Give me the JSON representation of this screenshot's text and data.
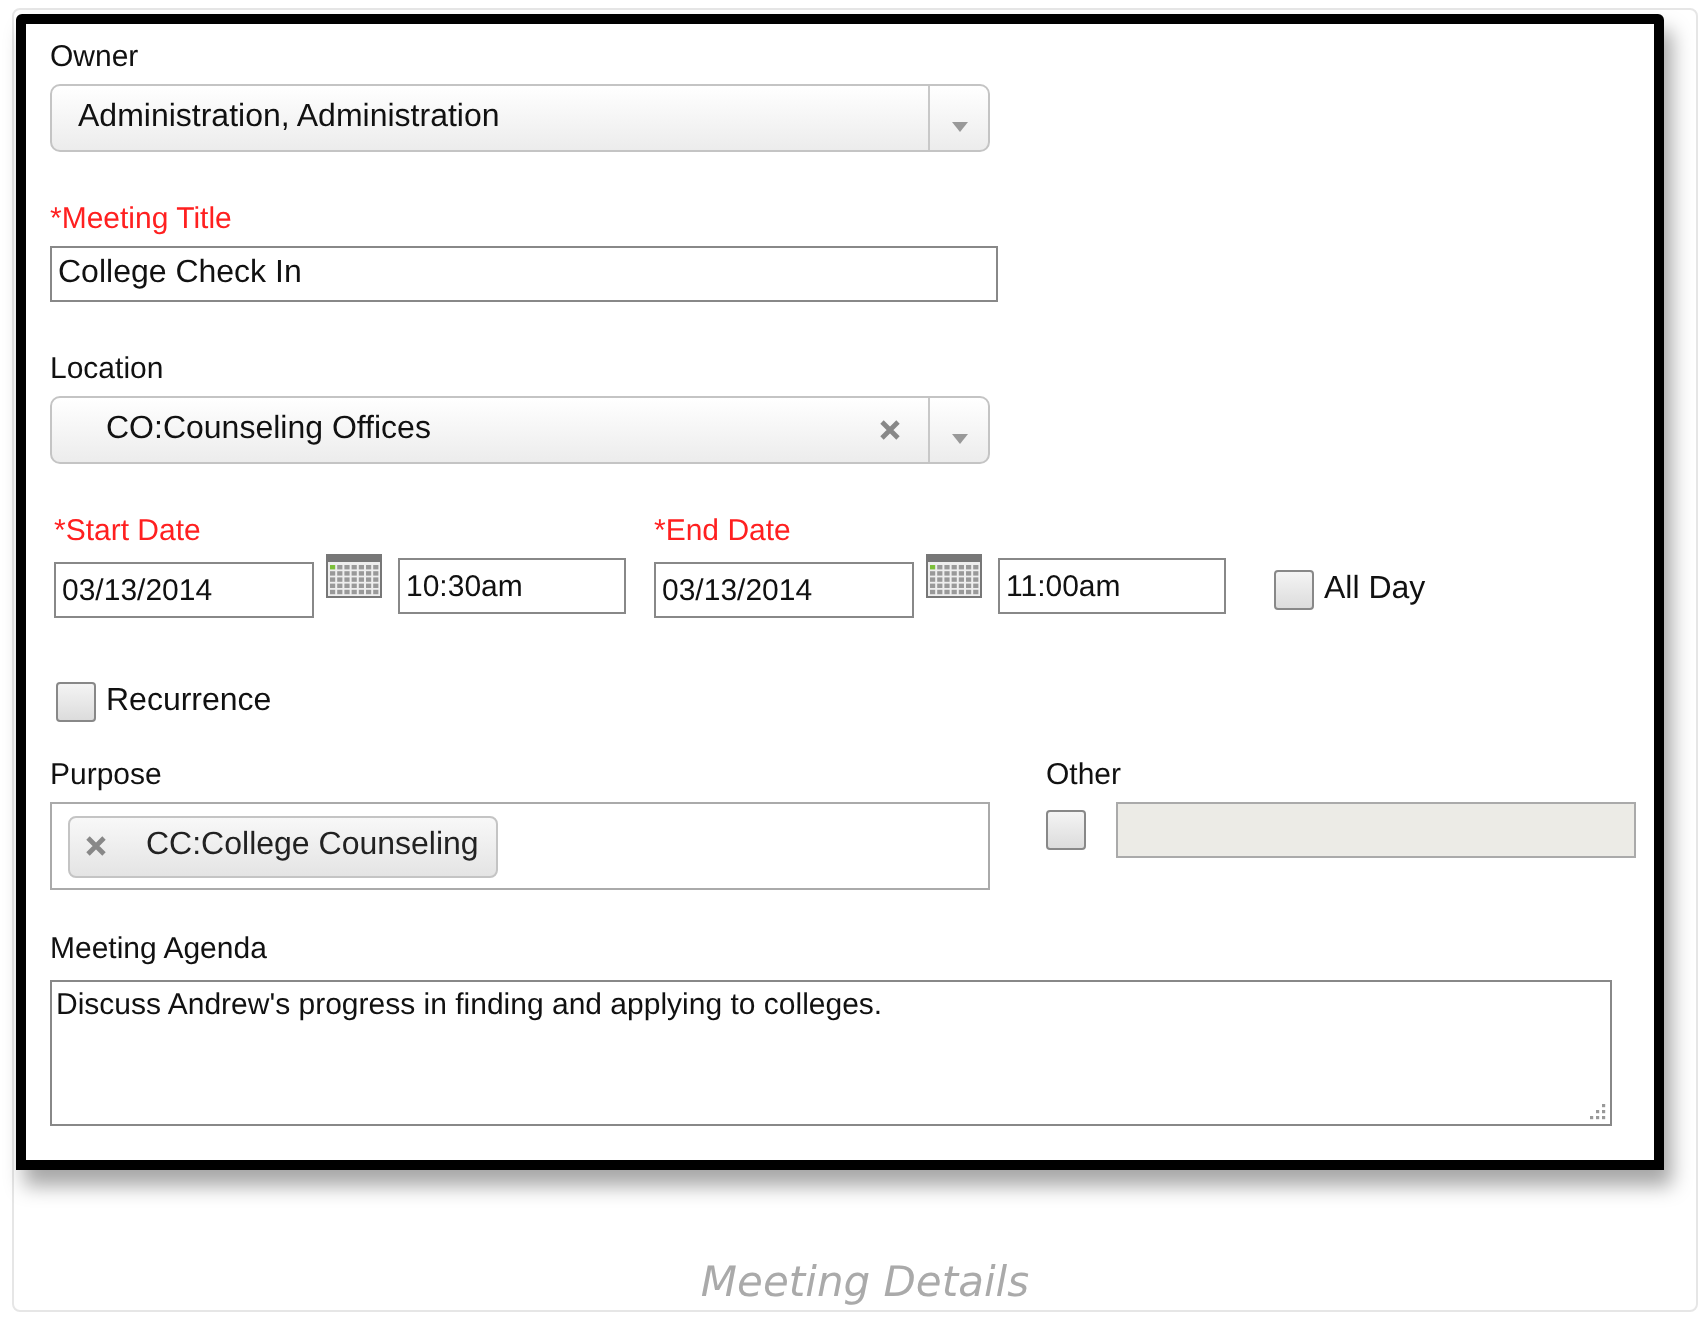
{
  "owner": {
    "label": "Owner",
    "required": false,
    "value": "Administration, Administration",
    "clearable": false
  },
  "meeting_title": {
    "label": "*Meeting Title",
    "required": true,
    "value": "College Check In"
  },
  "location": {
    "label": "Location",
    "required": false,
    "value": "CO:Counseling Offices",
    "clearable": true
  },
  "start": {
    "label": "*Start Date",
    "required": true,
    "date": "03/13/2014",
    "time": "10:30am"
  },
  "end": {
    "label": "*End Date",
    "required": true,
    "date": "03/13/2014",
    "time": "11:00am"
  },
  "all_day": {
    "label": "All Day",
    "checked": false
  },
  "recurrence": {
    "label": "Recurrence",
    "checked": false
  },
  "purpose": {
    "label": "Purpose",
    "tags": [
      {
        "label": "CC:College Counseling"
      }
    ]
  },
  "other": {
    "label": "Other",
    "checked": false,
    "disabled": true
  },
  "agenda": {
    "label": "Meeting Agenda",
    "value": "Discuss Andrew's progress in finding and applying to colleges."
  },
  "caption": "Meeting Details"
}
